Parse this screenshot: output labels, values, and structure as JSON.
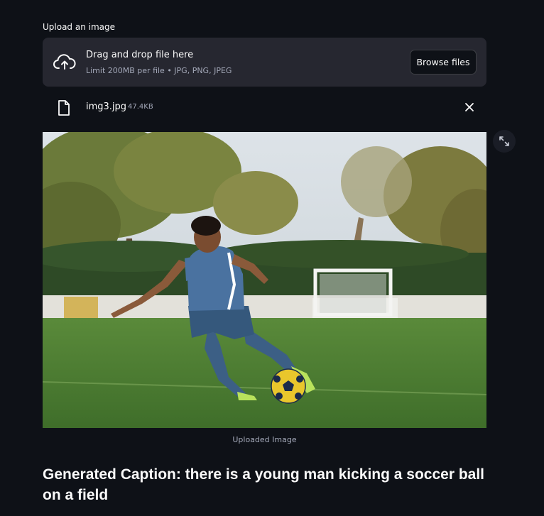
{
  "uploader": {
    "label": "Upload an image",
    "dropzone_title": "Drag and drop file here",
    "dropzone_limit": "Limit 200MB per file • JPG, PNG, JPEG",
    "browse_label": "Browse files",
    "icon": "cloud-upload-icon"
  },
  "file": {
    "name": "img3.jpg",
    "size": "47.4KB",
    "icon": "file-icon",
    "remove_icon": "close-icon"
  },
  "image": {
    "caption": "Uploaded Image",
    "expand_icon": "fullscreen-icon"
  },
  "result": {
    "caption_text": "Generated Caption: there is a young man kicking a soccer ball on a field"
  },
  "colors": {
    "background": "#0e1117",
    "panel": "#262730",
    "muted_text": "#a3a8b8"
  }
}
